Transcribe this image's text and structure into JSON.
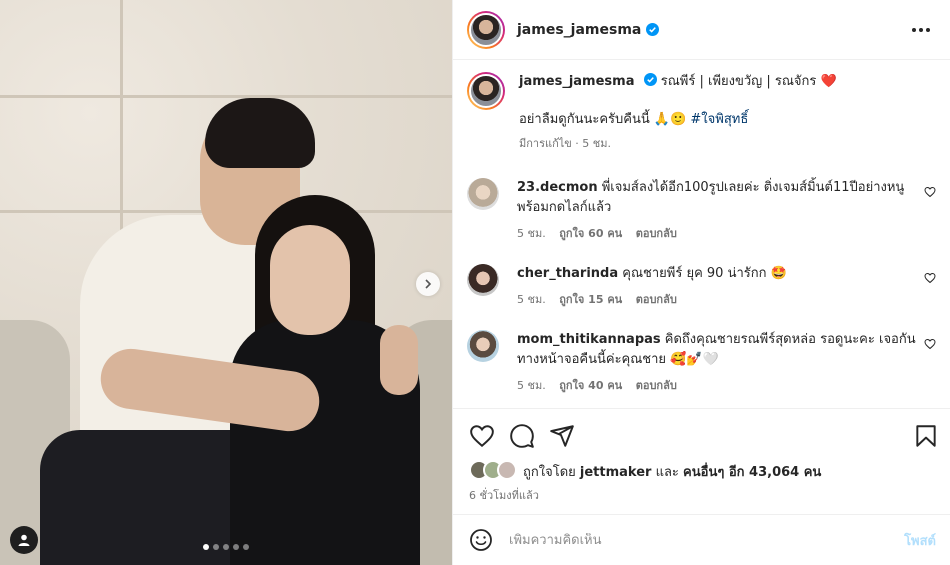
{
  "post": {
    "username": "james_jamesma",
    "carousel_total": 5,
    "carousel_index": 1
  },
  "caption": {
    "username": "james_jamesma",
    "title_text": "รณพีร์ | เพียงขวัญ | รณจักร",
    "title_emoji": "❤️",
    "body_text": "อย่าลืมดูกันนะครับคืนนี้ 🙏🙂",
    "hashtag": "#ใจพิสุทธิ์",
    "meta": "มีการแก้ไข · 5 ชม."
  },
  "comments": [
    {
      "username": "23.decmon",
      "text": "พี่เจมส์ลงได้อีก100รูปเลยค่ะ ติ่งเจมส์มิ้นต์11ปีอย่างหนู พร้อมกดไลก์แล้ว",
      "time": "5 ชม.",
      "likes": "ถูกใจ 60 คน",
      "reply": "ตอบกลับ"
    },
    {
      "username": "cher_tharinda",
      "text": "คุณชายพีร์ ยุค 90 น่ารักก 🤩",
      "time": "5 ชม.",
      "likes": "ถูกใจ 15 คน",
      "reply": "ตอบกลับ"
    },
    {
      "username": "mom_thitikannapas",
      "text": "คิดถึงคุณชายรณพีร์สุดหล่อ รอดูนะคะ เจอกันทางหน้าจอคืนนี้ค่ะคุณชาย 🥰💅🤍",
      "time": "5 ชม.",
      "likes": "ถูกใจ 40 คน",
      "reply": "ตอบกลับ"
    }
  ],
  "likes": {
    "prefix": "ถูกใจโดย",
    "user": "jettmaker",
    "middle": "และ",
    "others": "คนอื่นๆ อีก 43,064 คน"
  },
  "posted_time": "6 ชั่วโมงที่แล้ว",
  "comment_input": {
    "placeholder": "เพิ่มความคิดเห็น",
    "post_label": "โพสต์"
  },
  "icons": {
    "heart": "heart-icon",
    "comment": "comment-icon",
    "share": "share-icon",
    "save": "bookmark-icon",
    "emoji": "emoji-icon",
    "more": "more-options-icon",
    "next": "chevron-right-icon",
    "verified": "verified-badge-icon",
    "tag": "user-tag-icon"
  },
  "colors": {
    "verified": "#0095f6",
    "link": "#00376b",
    "post_button_disabled": "#b2dffc",
    "caption_heart": "#ed1c24"
  }
}
